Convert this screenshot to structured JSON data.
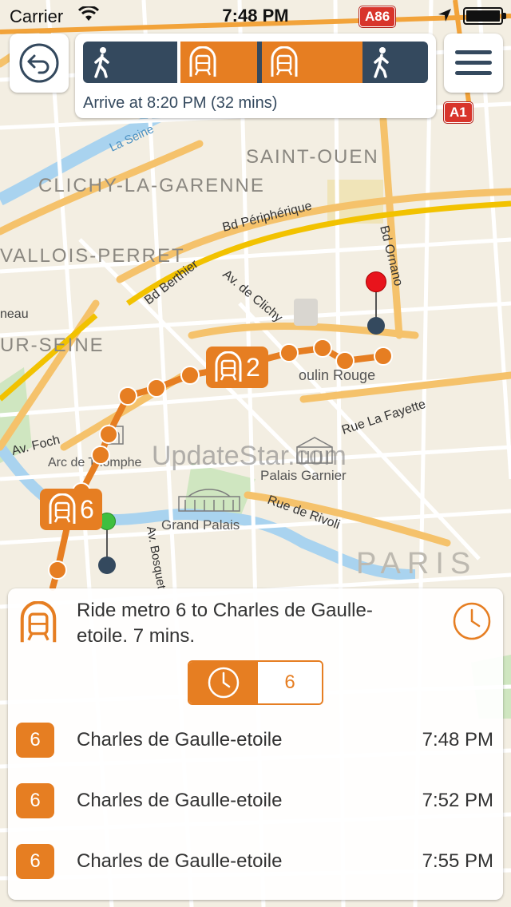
{
  "status_bar": {
    "carrier": "Carrier",
    "time": "7:48 PM"
  },
  "map": {
    "labels": {
      "saint_ouen": "SAINT-OUEN",
      "clichy": "CLICHY-LA-GARENNE",
      "levallois": "VALLOIS-PERRET",
      "seine_left": "UR-SEINE",
      "bd_peripherique": "Bd Périphérique",
      "bd_berthier": "Bd Berthier",
      "av_clichy": "Av. de Clichy",
      "bd_ornano": "Bd Ornano",
      "moulin_rouge": "oulin Rouge",
      "rue_la_fayette": "Rue La Fayette",
      "av_foch": "Av. Foch",
      "arc": "Arc de Triomphe",
      "palais_garnier": "Palais Garnier",
      "grand_palais": "Grand Palais",
      "rue_rivoli": "Rue de Rivoli",
      "paris": "PARIS",
      "la_seine": "La Seine",
      "av_bosquet": "Av. Bosquet",
      "neau": "neau"
    },
    "road_badges": {
      "a86": "A86",
      "a1": "A1"
    },
    "markers": {
      "metro_2_line": "2",
      "metro_6_line": "6"
    },
    "watermark": "UpdateStar.com"
  },
  "trip": {
    "legs": [
      {
        "type": "walk",
        "icon": "walk-icon"
      },
      {
        "type": "metro",
        "icon": "metro-icon"
      },
      {
        "type": "metro",
        "icon": "metro-icon"
      },
      {
        "type": "walk",
        "icon": "walk-icon"
      }
    ],
    "arrive_text": "Arrive at 8:20 PM (32 mins)"
  },
  "panel": {
    "instruction": "Ride metro 6 to Charles de Gaulle-etoile. 7 mins.",
    "segment_line": "6",
    "departures": [
      {
        "line": "6",
        "station": "Charles de Gaulle-etoile",
        "time": "7:48 PM"
      },
      {
        "line": "6",
        "station": "Charles de Gaulle-etoile",
        "time": "7:52 PM"
      },
      {
        "line": "6",
        "station": "Charles de Gaulle-etoile",
        "time": "7:55 PM"
      }
    ]
  },
  "colors": {
    "accent": "#e67e22",
    "walk": "#34495e",
    "pin_destination": "#e8141c",
    "pin_origin": "#3fbf3f"
  }
}
